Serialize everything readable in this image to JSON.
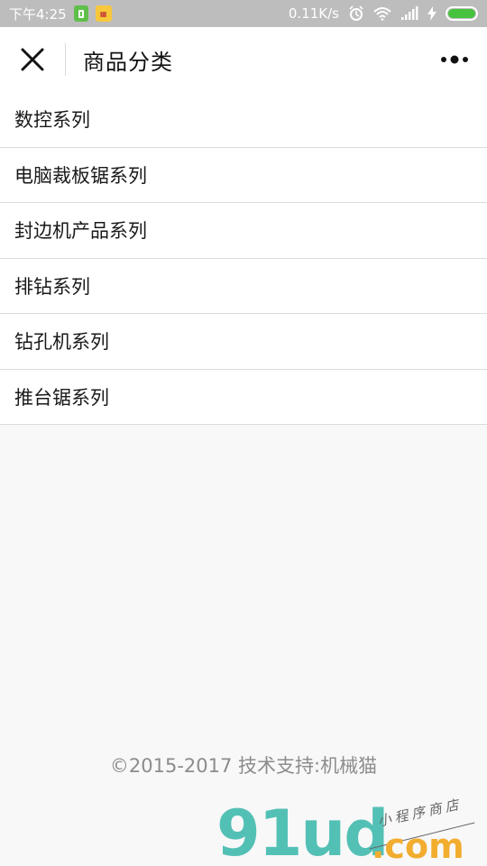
{
  "status_bar": {
    "time": "下午4:25",
    "network_speed": "0.11K/s",
    "icons": [
      "app-icon-green",
      "app-icon-yellow",
      "alarm-icon",
      "wifi-icon",
      "signal-icon",
      "charging-bolt-icon",
      "battery-icon"
    ],
    "battery_level": 1.0,
    "battery_color": "#46c23d"
  },
  "header": {
    "title": "商品分类",
    "close_icon": "close-icon",
    "more_icon": "more-options-icon"
  },
  "categories": [
    {
      "label": "数控系列"
    },
    {
      "label": "电脑裁板锯系列"
    },
    {
      "label": "封边机产品系列"
    },
    {
      "label": "排钻系列"
    },
    {
      "label": "钻孔机系列"
    },
    {
      "label": "推台锯系列"
    }
  ],
  "footer": {
    "copyright": "©2015-2017 技术支持:机械猫"
  },
  "watermark": {
    "brand": "91ud",
    "domain": ".com",
    "tagline": "小程序商店",
    "brand_color": "#53c0b5",
    "domain_color": "#f2ad2f"
  }
}
